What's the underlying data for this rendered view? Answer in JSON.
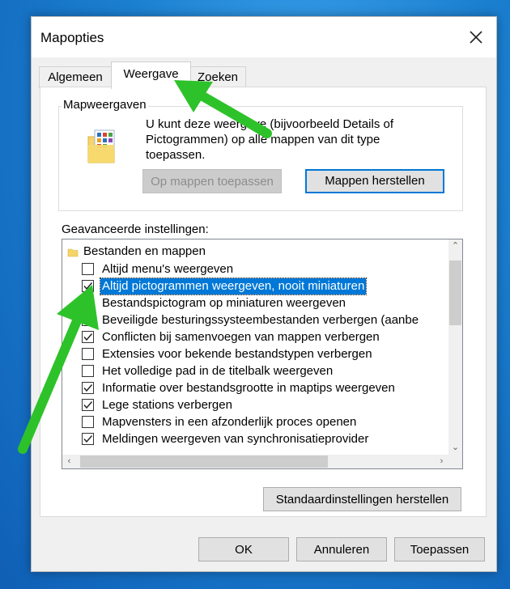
{
  "window": {
    "title": "Mapopties"
  },
  "tabs": [
    {
      "label": "Algemeen"
    },
    {
      "label": "Weergave"
    },
    {
      "label": "Zoeken"
    }
  ],
  "folder_views": {
    "group_title": "Mapweergaven",
    "description": "U kunt deze weergave (bijvoorbeeld Details of Pictogrammen) op alle mappen van dit type toepassen.",
    "apply_button": "Op mappen toepassen",
    "reset_button": "Mappen herstellen"
  },
  "advanced": {
    "label": "Geavanceerde instellingen:",
    "root": "Bestanden en mappen",
    "items": [
      {
        "label": "Altijd menu's weergeven",
        "checked": false,
        "selected": false
      },
      {
        "label": "Altijd pictogrammen weergeven, nooit miniaturen",
        "checked": true,
        "selected": true
      },
      {
        "label": "Bestandspictogram op miniaturen weergeven",
        "checked": true,
        "selected": false
      },
      {
        "label": "Beveiligde besturingssysteembestanden verbergen (aanbe",
        "checked": true,
        "selected": false
      },
      {
        "label": "Conflicten bij samenvoegen van mappen verbergen",
        "checked": true,
        "selected": false
      },
      {
        "label": "Extensies voor bekende bestandstypen verbergen",
        "checked": false,
        "selected": false
      },
      {
        "label": "Het volledige pad in de titelbalk weergeven",
        "checked": false,
        "selected": false
      },
      {
        "label": "Informatie over bestandsgrootte in maptips weergeven",
        "checked": true,
        "selected": false
      },
      {
        "label": "Lege stations verbergen",
        "checked": true,
        "selected": false
      },
      {
        "label": "Mapvensters in een afzonderlijk proces openen",
        "checked": false,
        "selected": false
      },
      {
        "label": "Meldingen weergeven van synchronisatieprovider",
        "checked": true,
        "selected": false
      }
    ],
    "restore_defaults": "Standaardinstellingen herstellen"
  },
  "footer": {
    "ok": "OK",
    "cancel": "Annuleren",
    "apply": "Toepassen"
  },
  "colors": {
    "accent": "#0078d7",
    "annotation_arrow": "#2ec22a"
  }
}
